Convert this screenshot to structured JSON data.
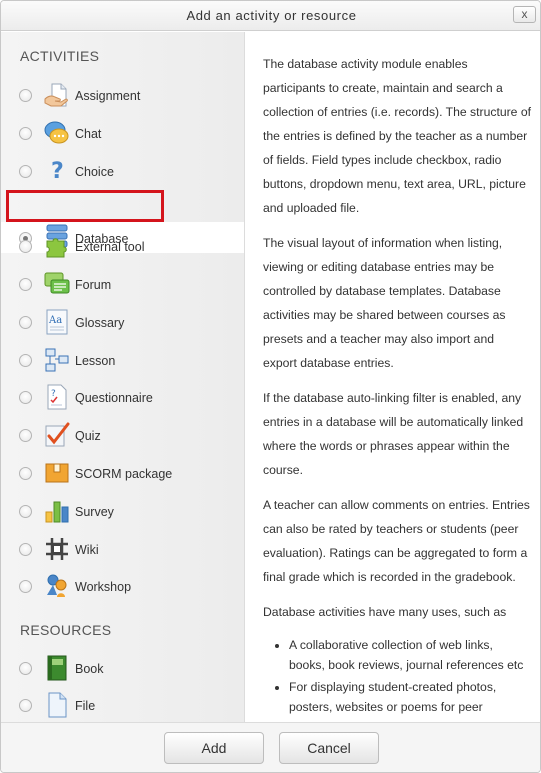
{
  "dialog": {
    "title": "Add an activity or resource",
    "close_label": "x"
  },
  "activities_heading": "ACTIVITIES",
  "resources_heading": "RESOURCES",
  "activities": [
    {
      "label": "Assignment",
      "icon": "assignment-icon",
      "selected": false
    },
    {
      "label": "Chat",
      "icon": "chat-icon",
      "selected": false
    },
    {
      "label": "Choice",
      "icon": "choice-icon",
      "selected": false
    },
    {
      "label": "Database",
      "icon": "database-icon",
      "selected": true
    },
    {
      "label": "External tool",
      "icon": "external-tool-icon",
      "selected": false
    },
    {
      "label": "Forum",
      "icon": "forum-icon",
      "selected": false
    },
    {
      "label": "Glossary",
      "icon": "glossary-icon",
      "selected": false
    },
    {
      "label": "Lesson",
      "icon": "lesson-icon",
      "selected": false
    },
    {
      "label": "Questionnaire",
      "icon": "questionnaire-icon",
      "selected": false
    },
    {
      "label": "Quiz",
      "icon": "quiz-icon",
      "selected": false
    },
    {
      "label": "SCORM package",
      "icon": "scorm-icon",
      "selected": false
    },
    {
      "label": "Survey",
      "icon": "survey-icon",
      "selected": false
    },
    {
      "label": "Wiki",
      "icon": "wiki-icon",
      "selected": false
    },
    {
      "label": "Workshop",
      "icon": "workshop-icon",
      "selected": false
    }
  ],
  "resources": [
    {
      "label": "Book",
      "icon": "book-icon",
      "selected": false
    },
    {
      "label": "File",
      "icon": "file-icon",
      "selected": false
    }
  ],
  "description": {
    "p1": "The database activity module enables participants to create, maintain and search a collection of entries (i.e. records). The structure of the entries is defined by the teacher as a number of fields. Field types include checkbox, radio buttons, dropdown menu, text area, URL, picture and uploaded file.",
    "p2": "The visual layout of information when listing, viewing or editing database entries may be controlled by database templates. Database activities may be shared between courses as presets and a teacher may also import and export database entries.",
    "p3": "If the database auto-linking filter is enabled, any entries in a database will be automatically linked where the words or phrases appear within the course.",
    "p4": "A teacher can allow comments on entries. Entries can also be rated by teachers or students (peer evaluation). Ratings can be aggregated to form a final grade which is recorded in the gradebook.",
    "p5": "Database activities have many uses, such as",
    "bullets": [
      "A collaborative collection of web links, books, book reviews, journal references etc",
      "For displaying student-created photos, posters, websites or poems for peer comment and review"
    ]
  },
  "buttons": {
    "add": "Add",
    "cancel": "Cancel"
  },
  "colors": {
    "highlight": "#d4141c"
  }
}
